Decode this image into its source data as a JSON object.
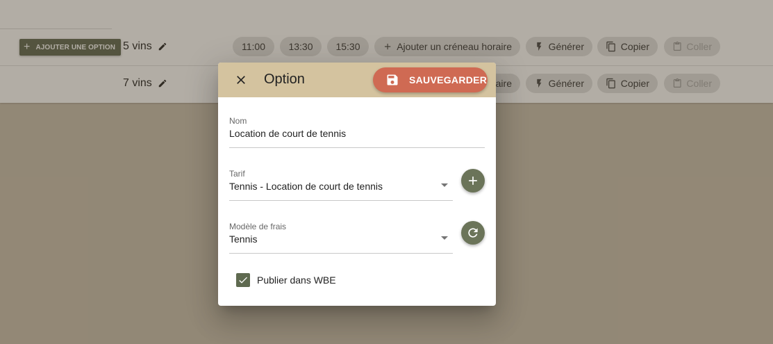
{
  "page": {
    "colors": {
      "accent": "#5d6650",
      "save": "#cf6a53",
      "header": "#d4c39f"
    },
    "add_option_label": "AJOUTER UNE OPTION",
    "rows": [
      {
        "wine_label": "5 vins",
        "times": [
          "11:00",
          "13:30",
          "15:30"
        ],
        "add_slot_label": "Ajouter un créneau horaire",
        "generate_label": "Générer",
        "copy_label": "Copier",
        "paste_label": "Coller"
      },
      {
        "wine_label": "7 vins",
        "partial_label": "aire",
        "generate_label": "Générer",
        "copy_label": "Copier",
        "paste_label": "Coller"
      }
    ]
  },
  "dialog": {
    "title": "Option",
    "save_label": "SAUVEGARDER",
    "fields": {
      "name": {
        "label": "Nom",
        "value": "Location de court de tennis"
      },
      "tariff": {
        "label": "Tarif",
        "value": "Tennis - Location de court de tennis"
      },
      "fee_model": {
        "label": "Modèle de frais",
        "value": "Tennis"
      }
    },
    "publish": {
      "label": "Publier dans WBE",
      "checked": true
    }
  }
}
